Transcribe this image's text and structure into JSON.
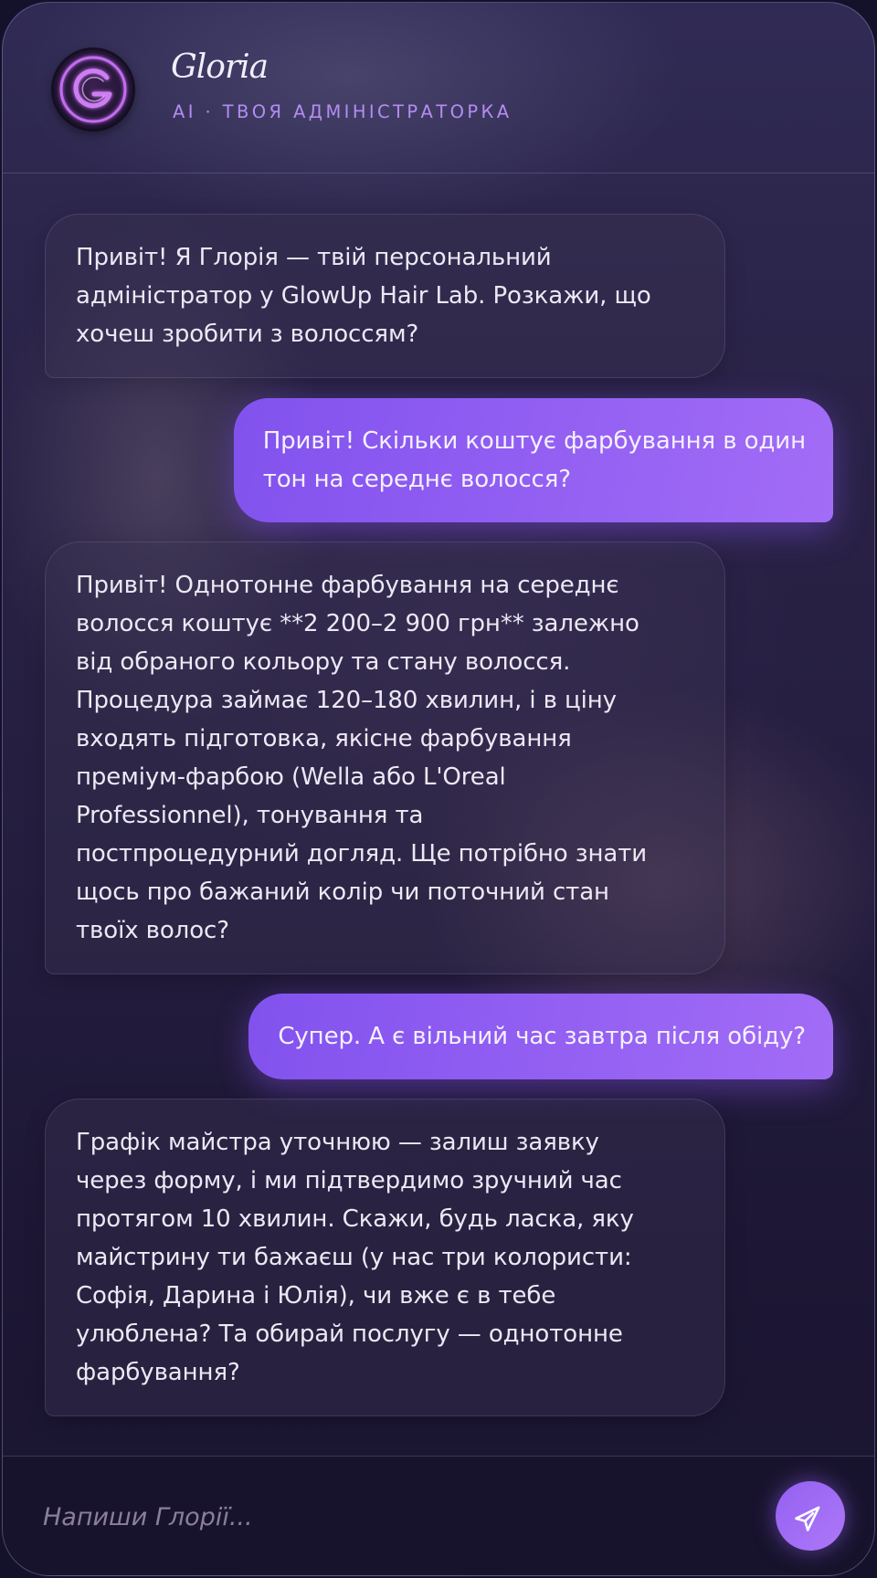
{
  "header": {
    "name": "Gloria",
    "subtitle": "AI · ТВОЯ АДМІНІСТРАТОРКА",
    "logo_letter": "G",
    "logo_icon": "neon-g-logo-icon"
  },
  "messages": [
    {
      "role": "bot",
      "text": "Привіт! Я Глорія — твій персональний\nадміністратор у GlowUp Hair Lab. Розкажи, що\nхочеш зробити з волоссям?"
    },
    {
      "role": "user",
      "text": "Привіт! Скільки коштує фарбування в один\nтон на середнє волосся?"
    },
    {
      "role": "bot",
      "text": "Привіт! Однотонне фарбування на середнє\nволосся коштує **2 200–2 900 грн** залежно\nвід обраного кольору та стану волосся.\nПроцедура займає 120–180 хвилин, і в ціну\nвходять підготовка, якісне фарбування\nпреміум-фарбою (Wella або L'Oreal\nProfessionnel), тонування та\nпостпроцедурний догляд. Ще потрібно знати\nщось про бажаний колір чи поточний стан\nтвоїх волос?"
    },
    {
      "role": "user",
      "text": "Супер. А є вільний час завтра після обіду?"
    },
    {
      "role": "bot",
      "text": "Графік майстра уточнюю — залиш заявку\nчерез форму, і ми підтвердимо зручний час\nпротягом 10 хвилин. Скажи, будь ласка, яку\nмайстрину ти бажаєш (у нас три колористи:\nСофія, Дарина і Юлія), чи вже є в тебе\nулюблена? Та обирай послугу — однотонне\nфарбування?"
    }
  ],
  "input": {
    "placeholder": "Напиши Глорії...",
    "value": ""
  },
  "send_button": {
    "icon": "send-paper-plane-icon"
  },
  "colors": {
    "accent": "#9461f2",
    "accent_light": "#ad78f7",
    "subtitle": "#b48cf2",
    "background_top": "#302b55",
    "background_bottom": "#1a1530",
    "text": "#ece8f4"
  }
}
